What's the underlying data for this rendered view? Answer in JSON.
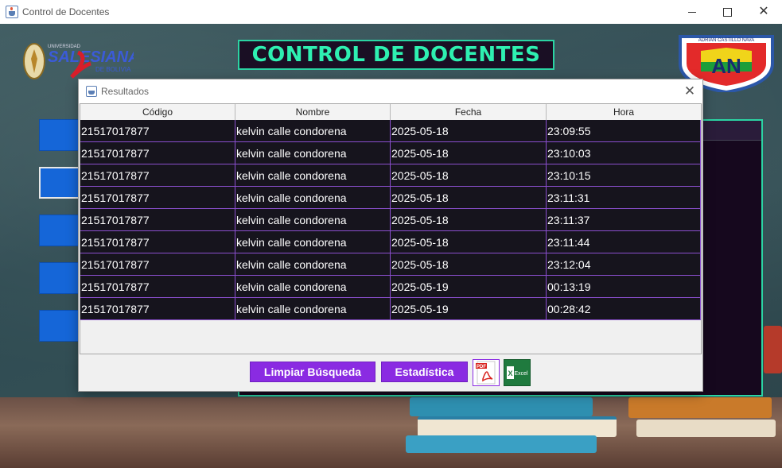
{
  "window": {
    "title": "Control de Docentes",
    "minimize_icon": "minimize-icon",
    "maximize_icon": "maximize-icon",
    "close_glyph": "✕"
  },
  "header": {
    "banner_title": "CONTROL DE DOCENTES",
    "left_logo_text_top": "UNIVERSIDAD",
    "left_logo_text_main": "SALESIANA",
    "left_logo_text_sub": "DE BOLIVIA",
    "right_logo_text": "ADRIAN CASTILLO NAVA"
  },
  "dialog": {
    "title": "Resultados",
    "close_glyph": "✕",
    "table": {
      "columns": [
        "Código",
        "Nombre",
        "Fecha",
        "Hora"
      ],
      "rows": [
        [
          "21517017877",
          "kelvin calle condorena",
          "2025-05-18",
          "23:09:55"
        ],
        [
          "21517017877",
          "kelvin calle condorena",
          "2025-05-18",
          "23:10:03"
        ],
        [
          "21517017877",
          "kelvin calle condorena",
          "2025-05-18",
          "23:10:15"
        ],
        [
          "21517017877",
          "kelvin calle condorena",
          "2025-05-18",
          "23:11:31"
        ],
        [
          "21517017877",
          "kelvin calle condorena",
          "2025-05-18",
          "23:11:37"
        ],
        [
          "21517017877",
          "kelvin calle condorena",
          "2025-05-18",
          "23:11:44"
        ],
        [
          "21517017877",
          "kelvin calle condorena",
          "2025-05-18",
          "23:12:04"
        ],
        [
          "21517017877",
          "kelvin calle condorena",
          "2025-05-19",
          "00:13:19"
        ],
        [
          "21517017877",
          "kelvin calle condorena",
          "2025-05-19",
          "00:28:42"
        ]
      ]
    },
    "buttons": {
      "clear_label": "Limpiar Búsqueda",
      "stats_label": "Estadística",
      "pdf_icon": "pdf-icon",
      "pdf_text": "PDF",
      "excel_icon": "excel-icon",
      "excel_text": "Excel"
    }
  },
  "colors": {
    "accent_purple": "#8a2be2",
    "banner_text": "#2ef0b1",
    "banner_border": "#2bd4a3",
    "row_bg": "#16141d",
    "row_border": "#8b4fcf",
    "side_button": "#1566d8"
  }
}
